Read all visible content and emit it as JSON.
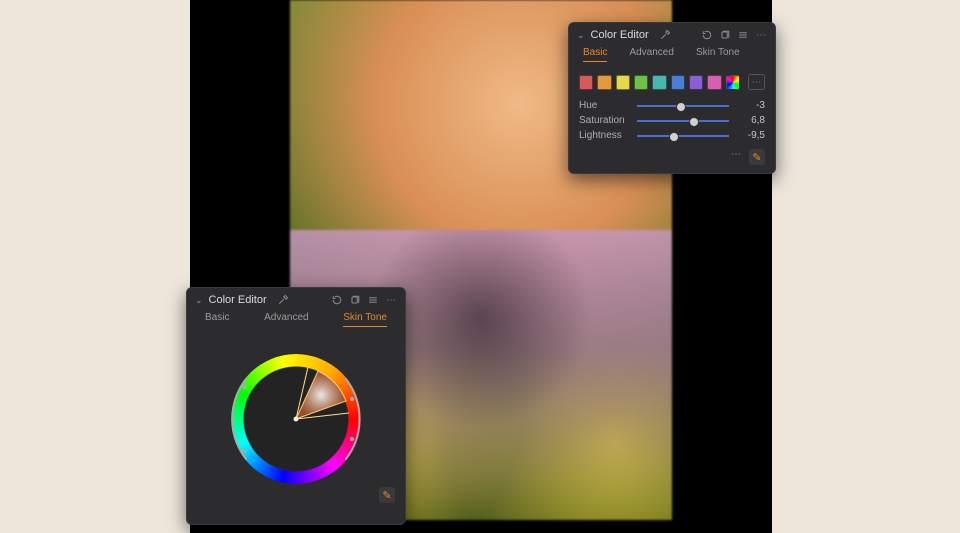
{
  "panel_basic": {
    "title": "Color Editor",
    "tabs": {
      "basic": "Basic",
      "advanced": "Advanced",
      "skin_tone": "Skin Tone"
    },
    "active_tab": "basic",
    "swatches": [
      "#d65a5a",
      "#e29a3e",
      "#e6d84b",
      "#6fbf4b",
      "#4bb6b0",
      "#4b7fd6",
      "#8a5fd6",
      "#d65fb0"
    ],
    "sliders": {
      "hue": {
        "label": "Hue",
        "value": "-3",
        "pos_pct": 48
      },
      "saturation": {
        "label": "Saturation",
        "value": "6,8",
        "pos_pct": 62
      },
      "lightness": {
        "label": "Lightness",
        "value": "-9,5",
        "pos_pct": 40
      }
    }
  },
  "panel_wheel": {
    "title": "Color Editor",
    "tabs": {
      "basic": "Basic",
      "advanced": "Advanced",
      "skin_tone": "Skin Tone"
    },
    "active_tab": "skin_tone"
  }
}
